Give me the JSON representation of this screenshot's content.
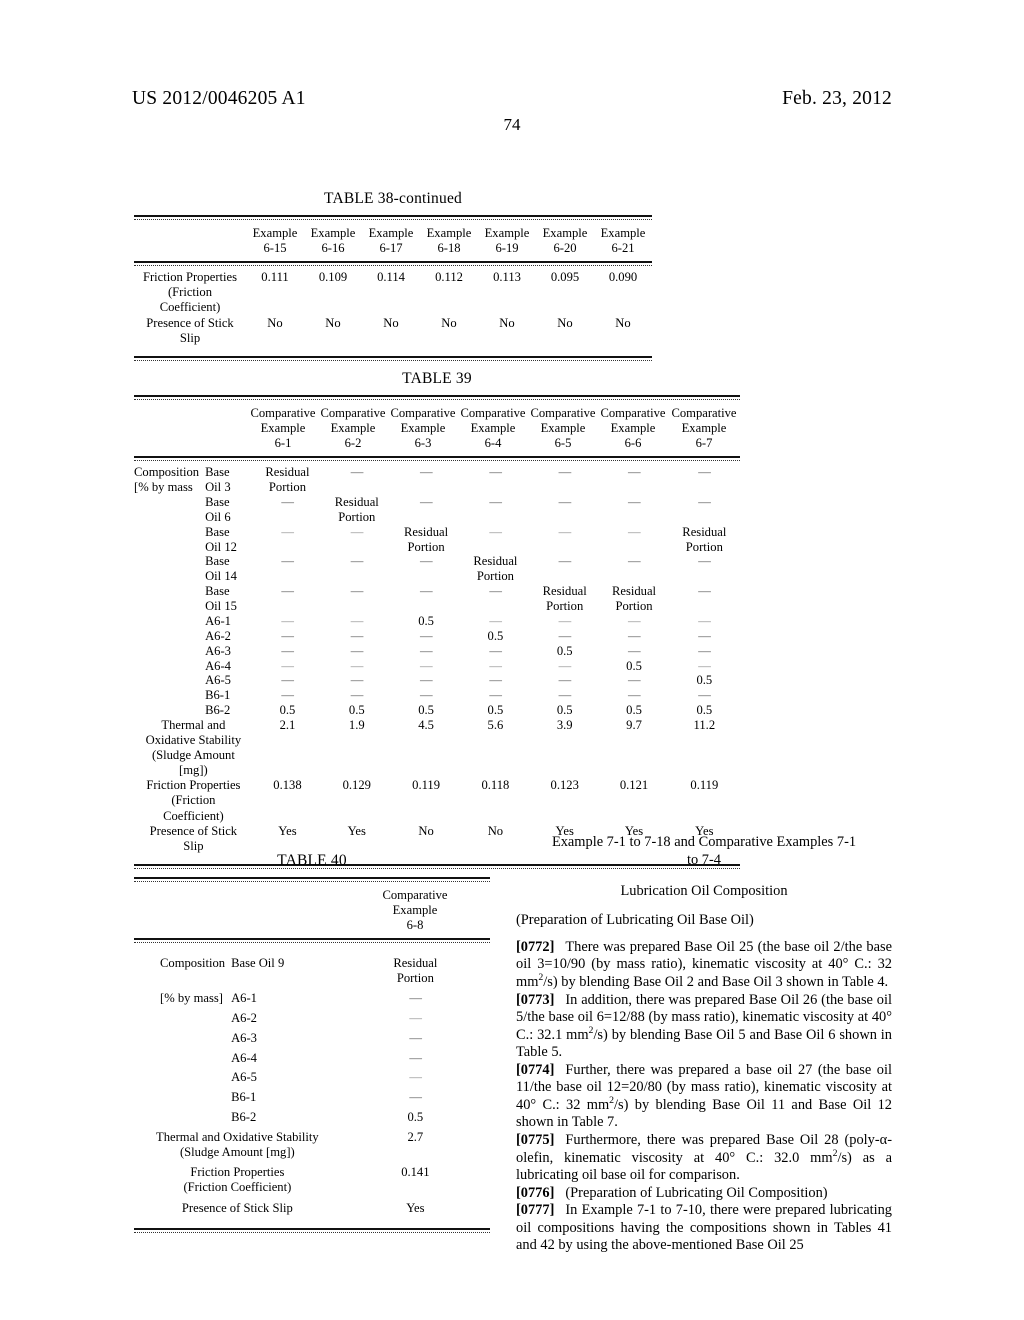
{
  "header": {
    "publication_number": "US 2012/0046205 A1",
    "publication_date": "Feb. 23, 2012",
    "page_number": "74"
  },
  "table38": {
    "caption": "TABLE 38-continued",
    "columns": [
      {
        "l1": "Example",
        "l2": "6-15"
      },
      {
        "l1": "Example",
        "l2": "6-16"
      },
      {
        "l1": "Example",
        "l2": "6-17"
      },
      {
        "l1": "Example",
        "l2": "6-18"
      },
      {
        "l1": "Example",
        "l2": "6-19"
      },
      {
        "l1": "Example",
        "l2": "6-20"
      },
      {
        "l1": "Example",
        "l2": "6-21"
      }
    ],
    "rows": [
      {
        "label_l1": "Friction Properties",
        "label_l2": "(Friction",
        "label_l3": "Coefficient)",
        "values": [
          "0.111",
          "0.109",
          "0.114",
          "0.112",
          "0.113",
          "0.095",
          "0.090"
        ]
      },
      {
        "label_l1": "Presence of Stick",
        "label_l2": "Slip",
        "label_l3": "",
        "values": [
          "No",
          "No",
          "No",
          "No",
          "No",
          "No",
          "No"
        ]
      }
    ]
  },
  "table39": {
    "caption": "TABLE 39",
    "columns": [
      {
        "l1": "Comparative",
        "l2": "Example",
        "l3": "6-1"
      },
      {
        "l1": "Comparative",
        "l2": "Example",
        "l3": "6-2"
      },
      {
        "l1": "Comparative",
        "l2": "Example",
        "l3": "6-3"
      },
      {
        "l1": "Comparative",
        "l2": "Example",
        "l3": "6-4"
      },
      {
        "l1": "Comparative",
        "l2": "Example",
        "l3": "6-5"
      },
      {
        "l1": "Comparative",
        "l2": "Example",
        "l3": "6-6"
      },
      {
        "l1": "Comparative",
        "l2": "Example",
        "l3": "6-7"
      }
    ],
    "group_label_l1": "Composition",
    "group_label_l2": "[% by mass",
    "rows": [
      {
        "name_l1": "Base",
        "name_l2": "Oil 3",
        "values": [
          "Residual Portion",
          "—",
          "—",
          "—",
          "—",
          "—",
          "—"
        ]
      },
      {
        "name_l1": "Base",
        "name_l2": "Oil 6",
        "values": [
          "—",
          "Residual Portion",
          "—",
          "—",
          "—",
          "—",
          "—"
        ]
      },
      {
        "name_l1": "Base",
        "name_l2": "Oil 12",
        "values": [
          "—",
          "—",
          "Residual Portion",
          "—",
          "—",
          "—",
          "Residual Portion"
        ]
      },
      {
        "name_l1": "Base",
        "name_l2": "Oil 14",
        "values": [
          "—",
          "—",
          "—",
          "Residual Portion",
          "—",
          "—",
          "—"
        ]
      },
      {
        "name_l1": "Base",
        "name_l2": "Oil 15",
        "values": [
          "—",
          "—",
          "—",
          "—",
          "Residual Portion",
          "Residual Portion",
          "—"
        ]
      },
      {
        "name_l1": "A6-1",
        "name_l2": "",
        "values": [
          "—",
          "—",
          "0.5",
          "—",
          "—",
          "—",
          "—"
        ]
      },
      {
        "name_l1": "A6-2",
        "name_l2": "",
        "values": [
          "—",
          "—",
          "—",
          "0.5",
          "—",
          "—",
          "—"
        ]
      },
      {
        "name_l1": "A6-3",
        "name_l2": "",
        "values": [
          "—",
          "—",
          "—",
          "—",
          "0.5",
          "—",
          "—"
        ]
      },
      {
        "name_l1": "A6-4",
        "name_l2": "",
        "values": [
          "—",
          "—",
          "—",
          "—",
          "—",
          "0.5",
          "—"
        ]
      },
      {
        "name_l1": "A6-5",
        "name_l2": "",
        "values": [
          "—",
          "—",
          "—",
          "—",
          "—",
          "—",
          "0.5"
        ]
      },
      {
        "name_l1": "B6-1",
        "name_l2": "",
        "values": [
          "—",
          "—",
          "—",
          "—",
          "—",
          "—",
          "—"
        ]
      },
      {
        "name_l1": "B6-2",
        "name_l2": "",
        "values": [
          "0.5",
          "0.5",
          "0.5",
          "0.5",
          "0.5",
          "0.5",
          "0.5"
        ]
      }
    ],
    "wide_rows": [
      {
        "label_l1": "Thermal and",
        "label_l2": "Oxidative Stability",
        "label_l3": "(Sludge Amount",
        "label_l4": "[mg])",
        "values": [
          "2.1",
          "1.9",
          "4.5",
          "5.6",
          "3.9",
          "9.7",
          "11.2"
        ]
      },
      {
        "label_l1": "Friction Properties",
        "label_l2": "(Friction",
        "label_l3": "Coefficient)",
        "label_l4": "",
        "values": [
          "0.138",
          "0.129",
          "0.119",
          "0.118",
          "0.123",
          "0.121",
          "0.119"
        ]
      },
      {
        "label_l1": "Presence of Stick",
        "label_l2": "Slip",
        "label_l3": "",
        "label_l4": "",
        "values": [
          "Yes",
          "Yes",
          "No",
          "No",
          "Yes",
          "Yes",
          "Yes"
        ]
      }
    ]
  },
  "table40": {
    "caption": "TABLE 40",
    "column": {
      "l1": "Comparative",
      "l2": "Example",
      "l3": "6-8"
    },
    "group_label_l1": "Composition",
    "group_label_l2": "[% by mass]",
    "rows": [
      {
        "name": "Base Oil 9",
        "value": "Residual Portion"
      },
      {
        "name": "A6-1",
        "value": "—"
      },
      {
        "name": "A6-2",
        "value": "—"
      },
      {
        "name": "A6-3",
        "value": "—"
      },
      {
        "name": "A6-4",
        "value": "—"
      },
      {
        "name": "A6-5",
        "value": "—"
      },
      {
        "name": "B6-1",
        "value": "—"
      },
      {
        "name": "B6-2",
        "value": "0.5"
      }
    ],
    "wide_rows": [
      {
        "label_l1": "Thermal and Oxidative Stability",
        "label_l2": "(Sludge Amount [mg])",
        "value": "2.7"
      },
      {
        "label_l1": "Friction Properties",
        "label_l2": "(Friction Coefficient)",
        "value": "0.141"
      },
      {
        "label_l1": "Presence of Stick Slip",
        "label_l2": "",
        "value": "Yes"
      }
    ]
  },
  "right_column": {
    "heading_line1": "Example 7-1 to 7-18 and Comparative Examples 7-1",
    "heading_line2": "to 7-4",
    "subheading": "Lubrication Oil Composition",
    "section_label": "(Preparation of Lubricating Oil Base Oil)",
    "paragraphs": [
      {
        "number": "[0772]",
        "text_a": "There was prepared Base Oil 25 (the base oil 2/the base oil 3=10/90 (by mass ratio), kinematic viscosity at 40° C.: 32 mm",
        "sup": "2",
        "text_b": "/s) by blending Base Oil 2 and Base Oil 3 shown in Table 4."
      },
      {
        "number": "[0773]",
        "text_a": "In addition, there was prepared Base Oil 26 (the base oil 5/the base oil 6=12/88 (by mass ratio), kinematic viscosity at 40° C.: 32.1 mm",
        "sup": "2",
        "text_b": "/s) by blending Base Oil 5 and Base Oil 6 shown in Table 5."
      },
      {
        "number": "[0774]",
        "text_a": "Further, there was prepared a base oil 27 (the base oil 11/the base oil 12=20/80 (by mass ratio), kinematic viscosity at 40° C.: 32 mm",
        "sup": "2",
        "text_b": "/s) by blending Base Oil 11 and Base Oil 12 shown in Table 7."
      },
      {
        "number": "[0775]",
        "text_a": "Furthermore, there was prepared Base Oil 28 (poly-α-olefin, kinematic viscosity at 40° C.: 32.0 mm",
        "sup": "2",
        "text_b": "/s) as a lubricating oil base oil for comparison."
      },
      {
        "number": "[0776]",
        "text_a": "(Preparation of Lubricating Oil Composition)",
        "sup": "",
        "text_b": ""
      },
      {
        "number": "[0777]",
        "text_a": "In Example 7-1 to 7-10, there were prepared lubricating oil compositions having the compositions shown in Tables 41 and 42 by using the above-mentioned Base Oil 25",
        "sup": "",
        "text_b": ""
      }
    ]
  }
}
